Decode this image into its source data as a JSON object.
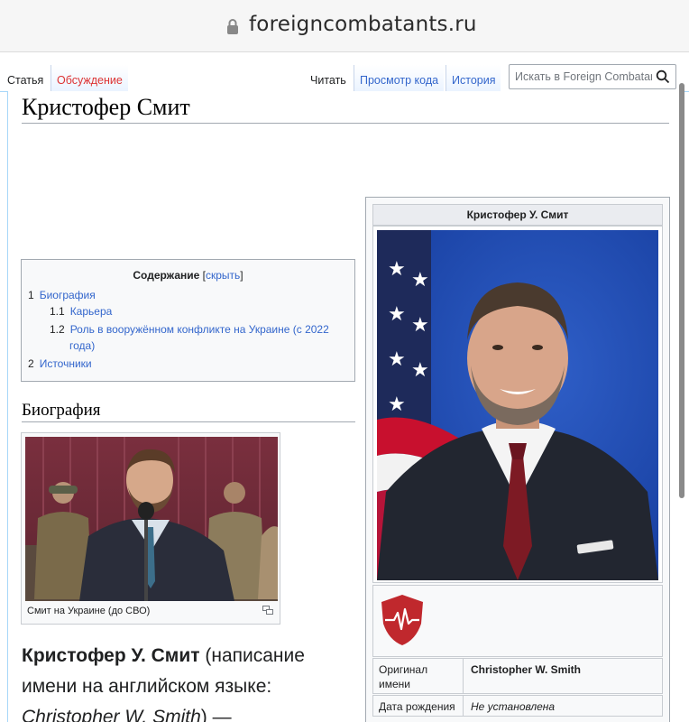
{
  "browser": {
    "url": "foreigncombatants.ru"
  },
  "tabs": {
    "left": [
      {
        "label": "Статья"
      },
      {
        "label": "Обсуждение"
      }
    ],
    "right": [
      {
        "label": "Читать"
      },
      {
        "label": "Просмотр кода"
      },
      {
        "label": "История"
      }
    ],
    "search_placeholder": "Искать в Foreign Combatants"
  },
  "page": {
    "title": "Кристофер Смит"
  },
  "toc": {
    "title": "Содержание",
    "toggle_open": "[",
    "toggle": "скрыть",
    "toggle_close": "]",
    "items": [
      {
        "num": "1",
        "text": "Биография"
      },
      {
        "num": "1.1",
        "text": "Карьера"
      },
      {
        "num": "1.2",
        "text": "Роль в вооружённом конфликте на Украине (с 2022"
      },
      {
        "num": "",
        "text": "года)"
      },
      {
        "num": "2",
        "text": "Источники"
      }
    ]
  },
  "section": {
    "heading": "Биография"
  },
  "thumb": {
    "caption": "Смит на Украине (до СВО)"
  },
  "lead": {
    "bold_name": "Кристофер У. Смит",
    "part1": " (написание имени на английском языке: ",
    "italic_name": "Christopher W. Smith",
    "part2": ") —"
  },
  "infobox": {
    "title": "Кристофер У. Смит",
    "rows": [
      {
        "label": "Оригинал имени",
        "value": "Christopher W. Smith"
      },
      {
        "label": "Дата рождения",
        "value": "Не установлена"
      }
    ]
  },
  "colors": {
    "link": "#3366cc",
    "link_red": "#dd3333",
    "accent_border": "#a7d7f9"
  }
}
